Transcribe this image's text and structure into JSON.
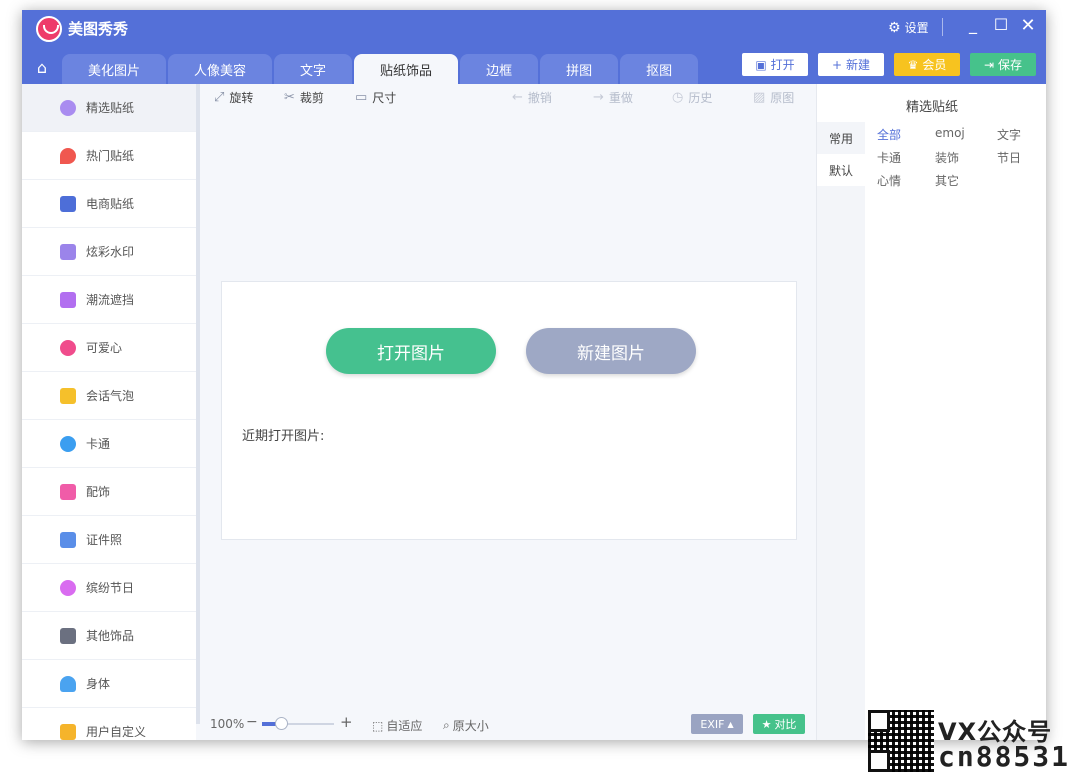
{
  "app": {
    "title": "美图秀秀",
    "settings_label": "设置"
  },
  "tabs": [
    "美化图片",
    "人像美容",
    "文字",
    "贴纸饰品",
    "边框",
    "拼图",
    "抠图"
  ],
  "active_tab": "贴纸饰品",
  "top_buttons": {
    "open": "打开",
    "new": "新建",
    "vip": "会员",
    "save": "保存"
  },
  "sidebar": [
    {
      "label": "精选贴纸",
      "color": "#a98cf0"
    },
    {
      "label": "热门贴纸",
      "color": "#f0574f"
    },
    {
      "label": "电商贴纸",
      "color": "#4d6ed8"
    },
    {
      "label": "炫彩水印",
      "color": "#9b84ea"
    },
    {
      "label": "潮流遮挡",
      "color": "#b26ff0"
    },
    {
      "label": "可爱心",
      "color": "#f04c8c"
    },
    {
      "label": "会话气泡",
      "color": "#f5c02b"
    },
    {
      "label": "卡通",
      "color": "#3b9ef0"
    },
    {
      "label": "配饰",
      "color": "#f05ca8"
    },
    {
      "label": "证件照",
      "color": "#5a8ee8"
    },
    {
      "label": "缤纷节日",
      "color": "#d96cf0"
    },
    {
      "label": "其他饰品",
      "color": "#6b7080"
    },
    {
      "label": "身体",
      "color": "#4aa3f0"
    },
    {
      "label": "用户自定义",
      "color": "#f5b42b"
    }
  ],
  "toolbar": {
    "rotate": "旋转",
    "crop": "裁剪",
    "size": "尺寸",
    "undo": "撤销",
    "redo": "重做",
    "history": "历史",
    "original": "原图"
  },
  "canvas": {
    "open_image": "打开图片",
    "new_image": "新建图片",
    "recent_label": "近期打开图片:"
  },
  "bottom": {
    "zoom": "100%",
    "fit": "自适应",
    "actual": "原大小",
    "exif": "EXIF",
    "compare": "对比"
  },
  "right_panel": {
    "title": "精选贴纸",
    "tabs": [
      "常用",
      "默认"
    ],
    "categories": [
      "全部",
      "emoj",
      "文字",
      "卡通",
      "装饰",
      "节日",
      "心情",
      "其它"
    ]
  },
  "watermark": {
    "line1": "VX公众号",
    "line2": "cn88531"
  }
}
